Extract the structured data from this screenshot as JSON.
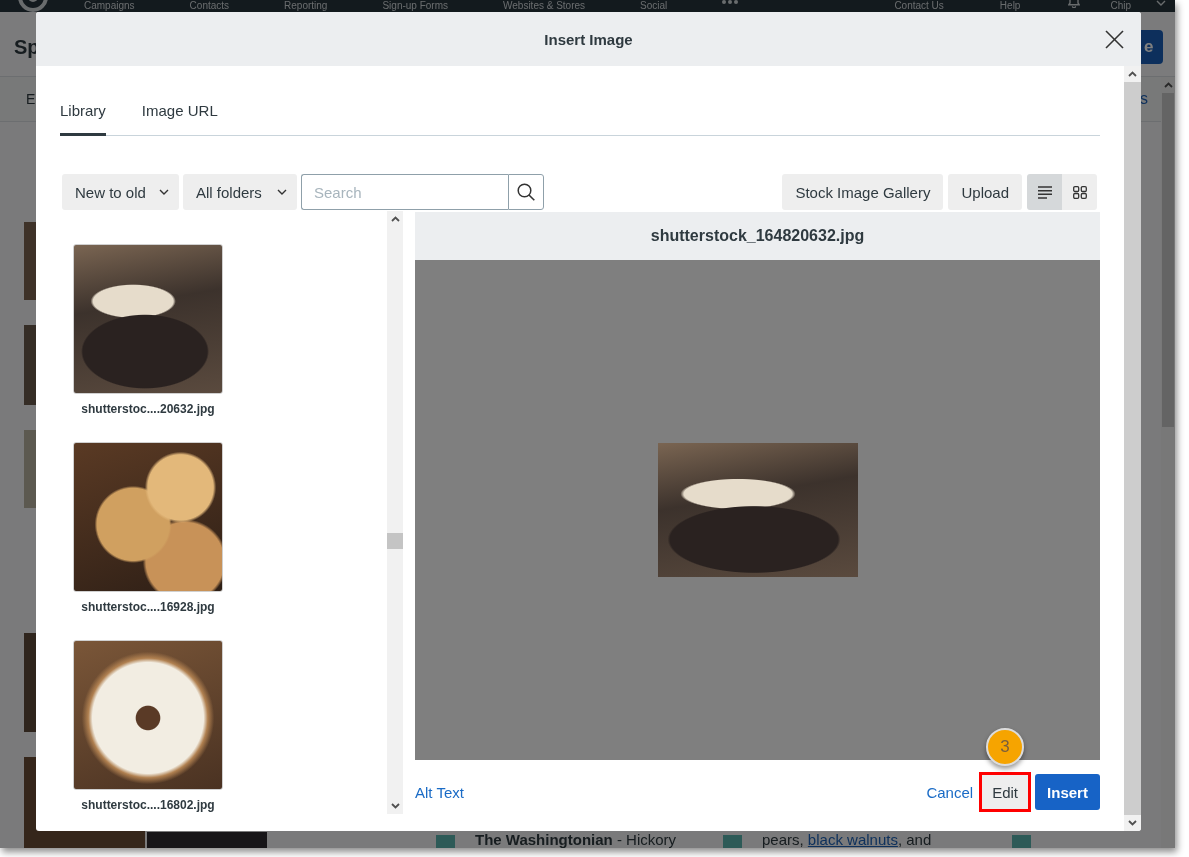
{
  "app": {
    "nav": {
      "items": [
        "Campaigns",
        "Contacts",
        "Reporting",
        "Sign-up Forms",
        "Websites & Stores",
        "Social"
      ],
      "right_items": [
        "Contact Us",
        "Help"
      ],
      "user": "Chip"
    },
    "header": {
      "title": "Sp",
      "button": "e"
    },
    "tab_bar": {
      "tab": "E",
      "link": "s"
    },
    "feed": [
      {
        "kind": "headline",
        "text": "**The Washingtonian** - Hickory"
      },
      {
        "kind": "linked",
        "before": "pears, ",
        "link": "black walnuts",
        "after": ", and"
      }
    ]
  },
  "dialog": {
    "title": "Insert Image",
    "tabs": [
      {
        "label": "Library",
        "selected": true
      },
      {
        "label": "Image URL",
        "selected": false
      }
    ],
    "toolbar": {
      "sort": "New to old",
      "folder": "All folders",
      "search": {
        "placeholder": "Search"
      },
      "buttons": [
        "Stock Image Gallery",
        "Upload"
      ],
      "views": [
        {
          "kind": "list",
          "selected": true
        },
        {
          "kind": "grid",
          "selected": false
        }
      ]
    },
    "library": {
      "items": [
        {
          "name": "shutterstoc....20632.jpg"
        },
        {
          "name": "shutterstoc....16928.jpg"
        },
        {
          "name": "shutterstoc....16802.jpg"
        }
      ]
    },
    "preview": {
      "filename": "shutterstock_164820632.jpg"
    },
    "footer": {
      "link": "Alt Text",
      "actions": [
        {
          "kind": "link",
          "label": "Cancel",
          "highlighted": false
        },
        {
          "kind": "secondary",
          "label": "Edit",
          "highlighted": true,
          "callout": "3"
        },
        {
          "kind": "primary",
          "label": "Insert",
          "highlighted": false
        }
      ]
    }
  }
}
